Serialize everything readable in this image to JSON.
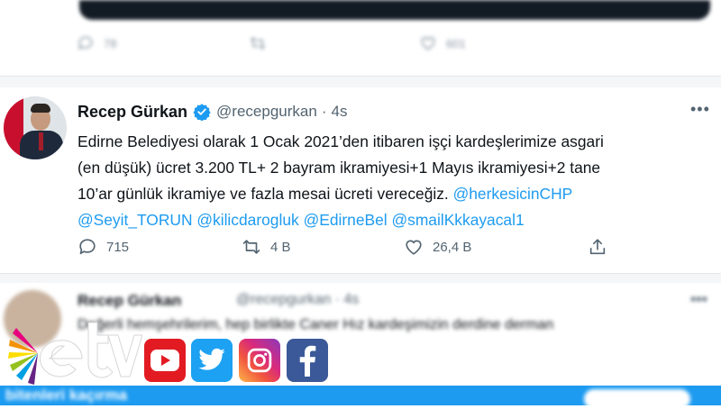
{
  "previous_tweet": {
    "banner_text": "",
    "reply_count": "78",
    "retweet_count": "",
    "like_count": "601"
  },
  "tweet": {
    "author_name": "Recep Gürkan",
    "author_handle": "@recepgurkan",
    "separator": "·",
    "time": "4s",
    "text_lines": [
      "Edirne Belediyesi olarak 1 Ocak 2021’den itibaren işçi kardeşlerimize asgari",
      "(en düşük) ücret 3.200 TL+ 2 bayram ikramiyesi+1 Mayıs ikramiyesi+2 tane",
      "10’ar günlük ikramiye ve fazla mesai ücreti vereceğiz. "
    ],
    "mentions_line3": "@herkesicinCHP",
    "mentions_line4": [
      "@Seyit_TORUN",
      "@kilicdarogluk",
      "@EdirneBel",
      "@smailKkkayacal1"
    ],
    "reply_count": "715",
    "retweet_count": "4 B",
    "like_count": "26,4 B"
  },
  "next_tweet": {
    "author_name": "Recep Gürkan",
    "author_handle": "@recepgurkan · 4s",
    "text": "Değerli hemşehrilerim, hep birlikte Caner Hız kardeşimizin derdine derman"
  },
  "bottom_bar": {
    "text": "bitenleri kaçırma"
  },
  "overlay": {
    "brand": "etv",
    "social_icons": [
      "youtube-icon",
      "twitter-icon",
      "instagram-icon",
      "facebook-icon"
    ]
  },
  "colors": {
    "accent": "#1d9bf0",
    "text": "#0f1419",
    "muted": "#536471"
  }
}
